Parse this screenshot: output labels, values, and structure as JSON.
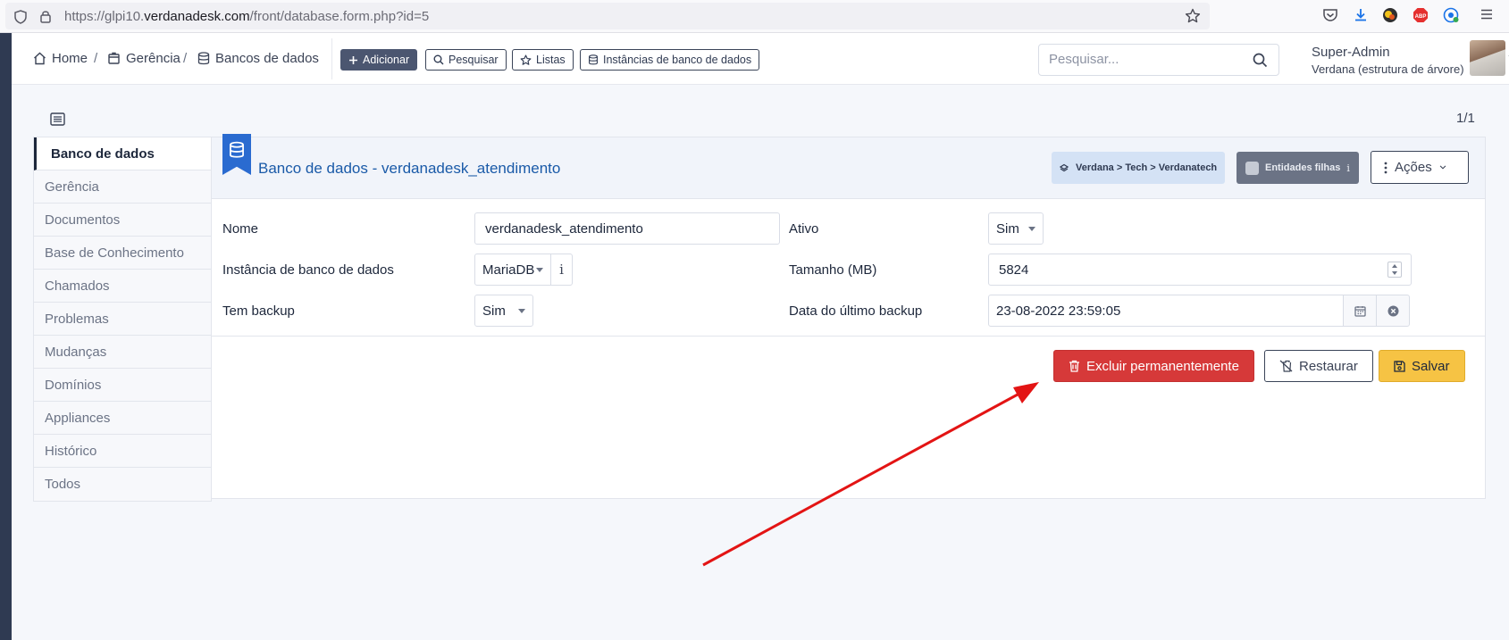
{
  "browser": {
    "url_prefix": "https://glpi10.",
    "url_domain": "verdanadesk.com",
    "url_path": "/front/database.form.php?id=5",
    "ext_abp": "ABP"
  },
  "breadcrumb": {
    "home": "Home",
    "sep1": "/",
    "gerencia": "Gerência",
    "sep2": "/",
    "databases": "Bancos de dados"
  },
  "toolbar": {
    "add": "Adicionar",
    "search": "Pesquisar",
    "lists": "Listas",
    "instances": "Instâncias de banco de dados"
  },
  "global_search": {
    "placeholder": "Pesquisar..."
  },
  "user": {
    "name": "Super-Admin",
    "entity": "Verdana (estrutura de árvore)"
  },
  "pager": "1/1",
  "tabs": [
    "Banco de dados",
    "Gerência",
    "Documentos",
    "Base de Conhecimento",
    "Chamados",
    "Problemas",
    "Mudanças",
    "Domínios",
    "Appliances",
    "Histórico",
    "Todos"
  ],
  "card": {
    "title": "Banco de dados - verdanadesk_atendimento",
    "entity_path": "Verdana > Tech > Verdanatech",
    "child_entities": "Entidades filhas",
    "child_info": "i",
    "actions": "Ações"
  },
  "form": {
    "name_label": "Nome",
    "name_value": "verdanadesk_atendimento",
    "active_label": "Ativo",
    "active_value": "Sim",
    "instance_label": "Instância de banco de dados",
    "instance_value": "MariaDB",
    "instance_info": "i",
    "size_label": "Tamanho (MB)",
    "size_value": "5824",
    "backup_label": "Tem backup",
    "backup_value": "Sim",
    "last_backup_label": "Data do último backup",
    "last_backup_value": "23-08-2022 23:59:05"
  },
  "actions": {
    "delete": "Excluir permanentemente",
    "restore": "Restaurar",
    "save": "Salvar"
  },
  "colors": {
    "danger": "#d63939",
    "warning": "#f6c344",
    "primary": "#2a6bd0",
    "sidebar": "#2f3a52",
    "annotation_arrow": "#e31414"
  }
}
